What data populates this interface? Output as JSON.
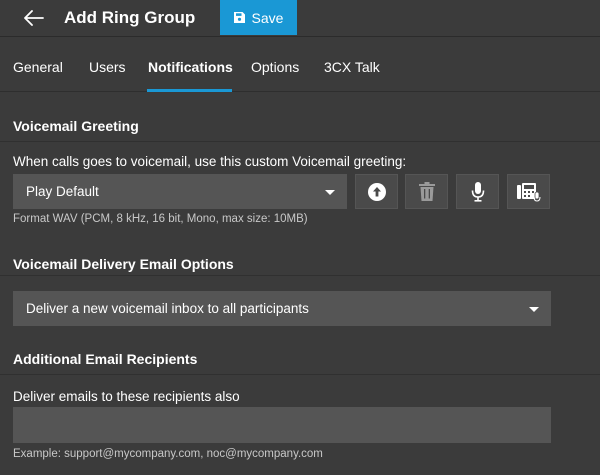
{
  "header": {
    "title": "Add Ring Group",
    "save_label": "Save",
    "accent": "#1a98d5"
  },
  "tabs": [
    {
      "label": "General",
      "active": false
    },
    {
      "label": "Users",
      "active": false
    },
    {
      "label": "Notifications",
      "active": true
    },
    {
      "label": "Options",
      "active": false
    },
    {
      "label": "3CX Talk",
      "active": false
    }
  ],
  "voicemail_greeting": {
    "title": "Voicemail Greeting",
    "description": "When calls goes to voicemail, use this custom Voicemail greeting:",
    "selected": "Play Default",
    "format_hint": "Format WAV (PCM, 8 kHz, 16 bit, Mono, max size: 10MB)",
    "actions": [
      "upload-icon",
      "trash-icon",
      "microphone-icon",
      "phone-record-icon"
    ]
  },
  "delivery": {
    "title": "Voicemail Delivery Email Options",
    "selected": "Deliver a new voicemail inbox to all participants"
  },
  "recipients": {
    "title": "Additional Email Recipients",
    "label": "Deliver emails to these recipients also",
    "value": "",
    "example": "Example: support@mycompany.com, noc@mycompany.com"
  }
}
